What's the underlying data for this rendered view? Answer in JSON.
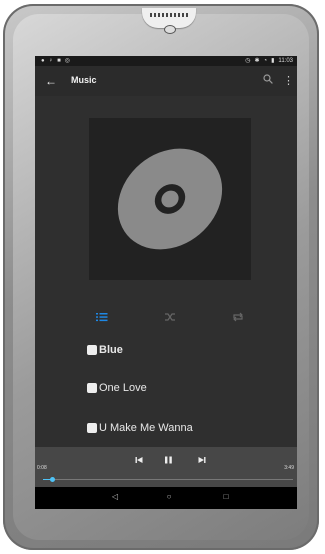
{
  "status_bar": {
    "time": "11:03"
  },
  "toolbar": {
    "back_icon": "arrow-left-icon",
    "title": "Music",
    "search_icon": "search-icon",
    "overflow_icon": "more-vert-icon"
  },
  "playback_modes": {
    "list_icon": "playlist-icon",
    "shuffle_icon": "shuffle-icon",
    "repeat_icon": "repeat-icon",
    "active_color": "#1e88e5"
  },
  "songs": [
    {
      "title": "Blue",
      "current": true
    },
    {
      "title": "One Love",
      "current": false
    },
    {
      "title": "U Make Me Wanna",
      "current": false
    }
  ],
  "player": {
    "elapsed": "0:08",
    "duration": "3:49",
    "progress": 0.035,
    "state": "playing"
  },
  "colors": {
    "background": "#2f2f2f",
    "accent": "#4fc3f7"
  }
}
